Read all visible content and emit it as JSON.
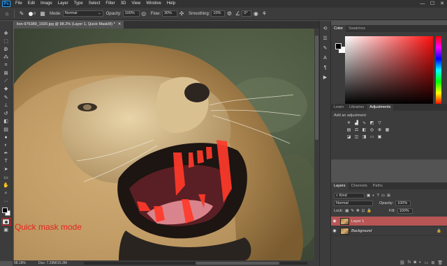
{
  "app": {
    "logo": "Ps",
    "menu": [
      "File",
      "Edit",
      "Image",
      "Layer",
      "Type",
      "Select",
      "Filter",
      "3D",
      "View",
      "Window",
      "Help"
    ],
    "window_controls": [
      "—",
      "☐",
      "✕"
    ]
  },
  "options_bar": {
    "brush_size": "0",
    "mode_label": "Mode:",
    "mode_value": "Normal",
    "opacity_label": "Opacity:",
    "opacity_value": "100%",
    "flow_label": "Flow:",
    "flow_value": "30%",
    "smoothing_label": "Smoothing:",
    "smoothing_value": "10%",
    "angle_value": "0°"
  },
  "document": {
    "tab_title": "lion-976389_1920.jpg @ 98.2% (Layer 1, Quick Mask/8) *",
    "zoom": "98.18%",
    "doc_size": "Doc: 7.29M/15.3M"
  },
  "annotation": "Quick mask mode",
  "panels": {
    "color_tabs": [
      "Color",
      "Swatches"
    ],
    "adjust_tabs": [
      "Learn",
      "Libraries",
      "Adjustments"
    ],
    "adjust_hint": "Add an adjustment",
    "layers_tabs": [
      "Layers",
      "Channels",
      "Paths"
    ],
    "filter_label": "Kind",
    "blend_mode": "Normal",
    "opacity_label": "Opacity:",
    "opacity_value": "100%",
    "lock_label": "Lock:",
    "fill_label": "Fill:",
    "fill_value": "100%",
    "layers": [
      {
        "name": "Layer 1",
        "selected": true
      },
      {
        "name": "Background",
        "selected": false
      }
    ]
  },
  "colors": {
    "accent_red": "#e8241e",
    "selected_layer": "#b85555",
    "panel_bg": "#3c3c3c"
  }
}
